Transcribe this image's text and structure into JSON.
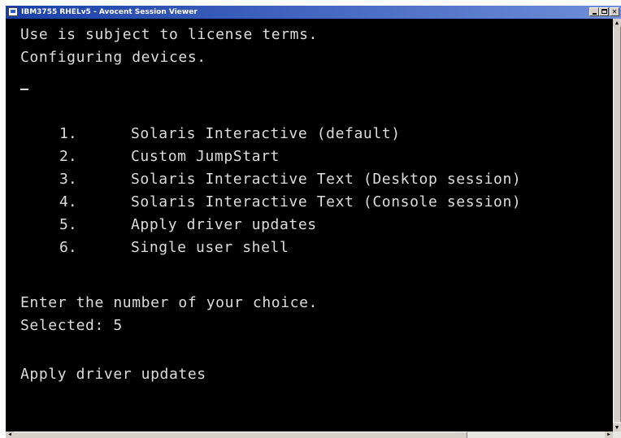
{
  "window": {
    "title": "IBM3755 RHELv5 - Avocent Session Viewer",
    "title_bar_color": "#1a3fa8",
    "icons": {
      "app": "app-icon",
      "minimize": "minimize-icon",
      "maximize": "maximize-icon",
      "close": "close-icon"
    }
  },
  "terminal": {
    "background": "#000000",
    "foreground": "#dcdcdc",
    "lines": [
      "Use is subject to license terms.",
      "Configuring devices.",
      "_"
    ],
    "menu": [
      {
        "num": "1.",
        "label": "Solaris Interactive (default)"
      },
      {
        "num": "2.",
        "label": "Custom JumpStart"
      },
      {
        "num": "3.",
        "label": "Solaris Interactive Text (Desktop session)"
      },
      {
        "num": "4.",
        "label": "Solaris Interactive Text (Console session)"
      },
      {
        "num": "5.",
        "label": "Apply driver updates"
      },
      {
        "num": "6.",
        "label": "Single user shell"
      }
    ],
    "prompt": "Enter the number of your choice.",
    "selected": "Selected: 5",
    "result": "Apply driver updates"
  }
}
